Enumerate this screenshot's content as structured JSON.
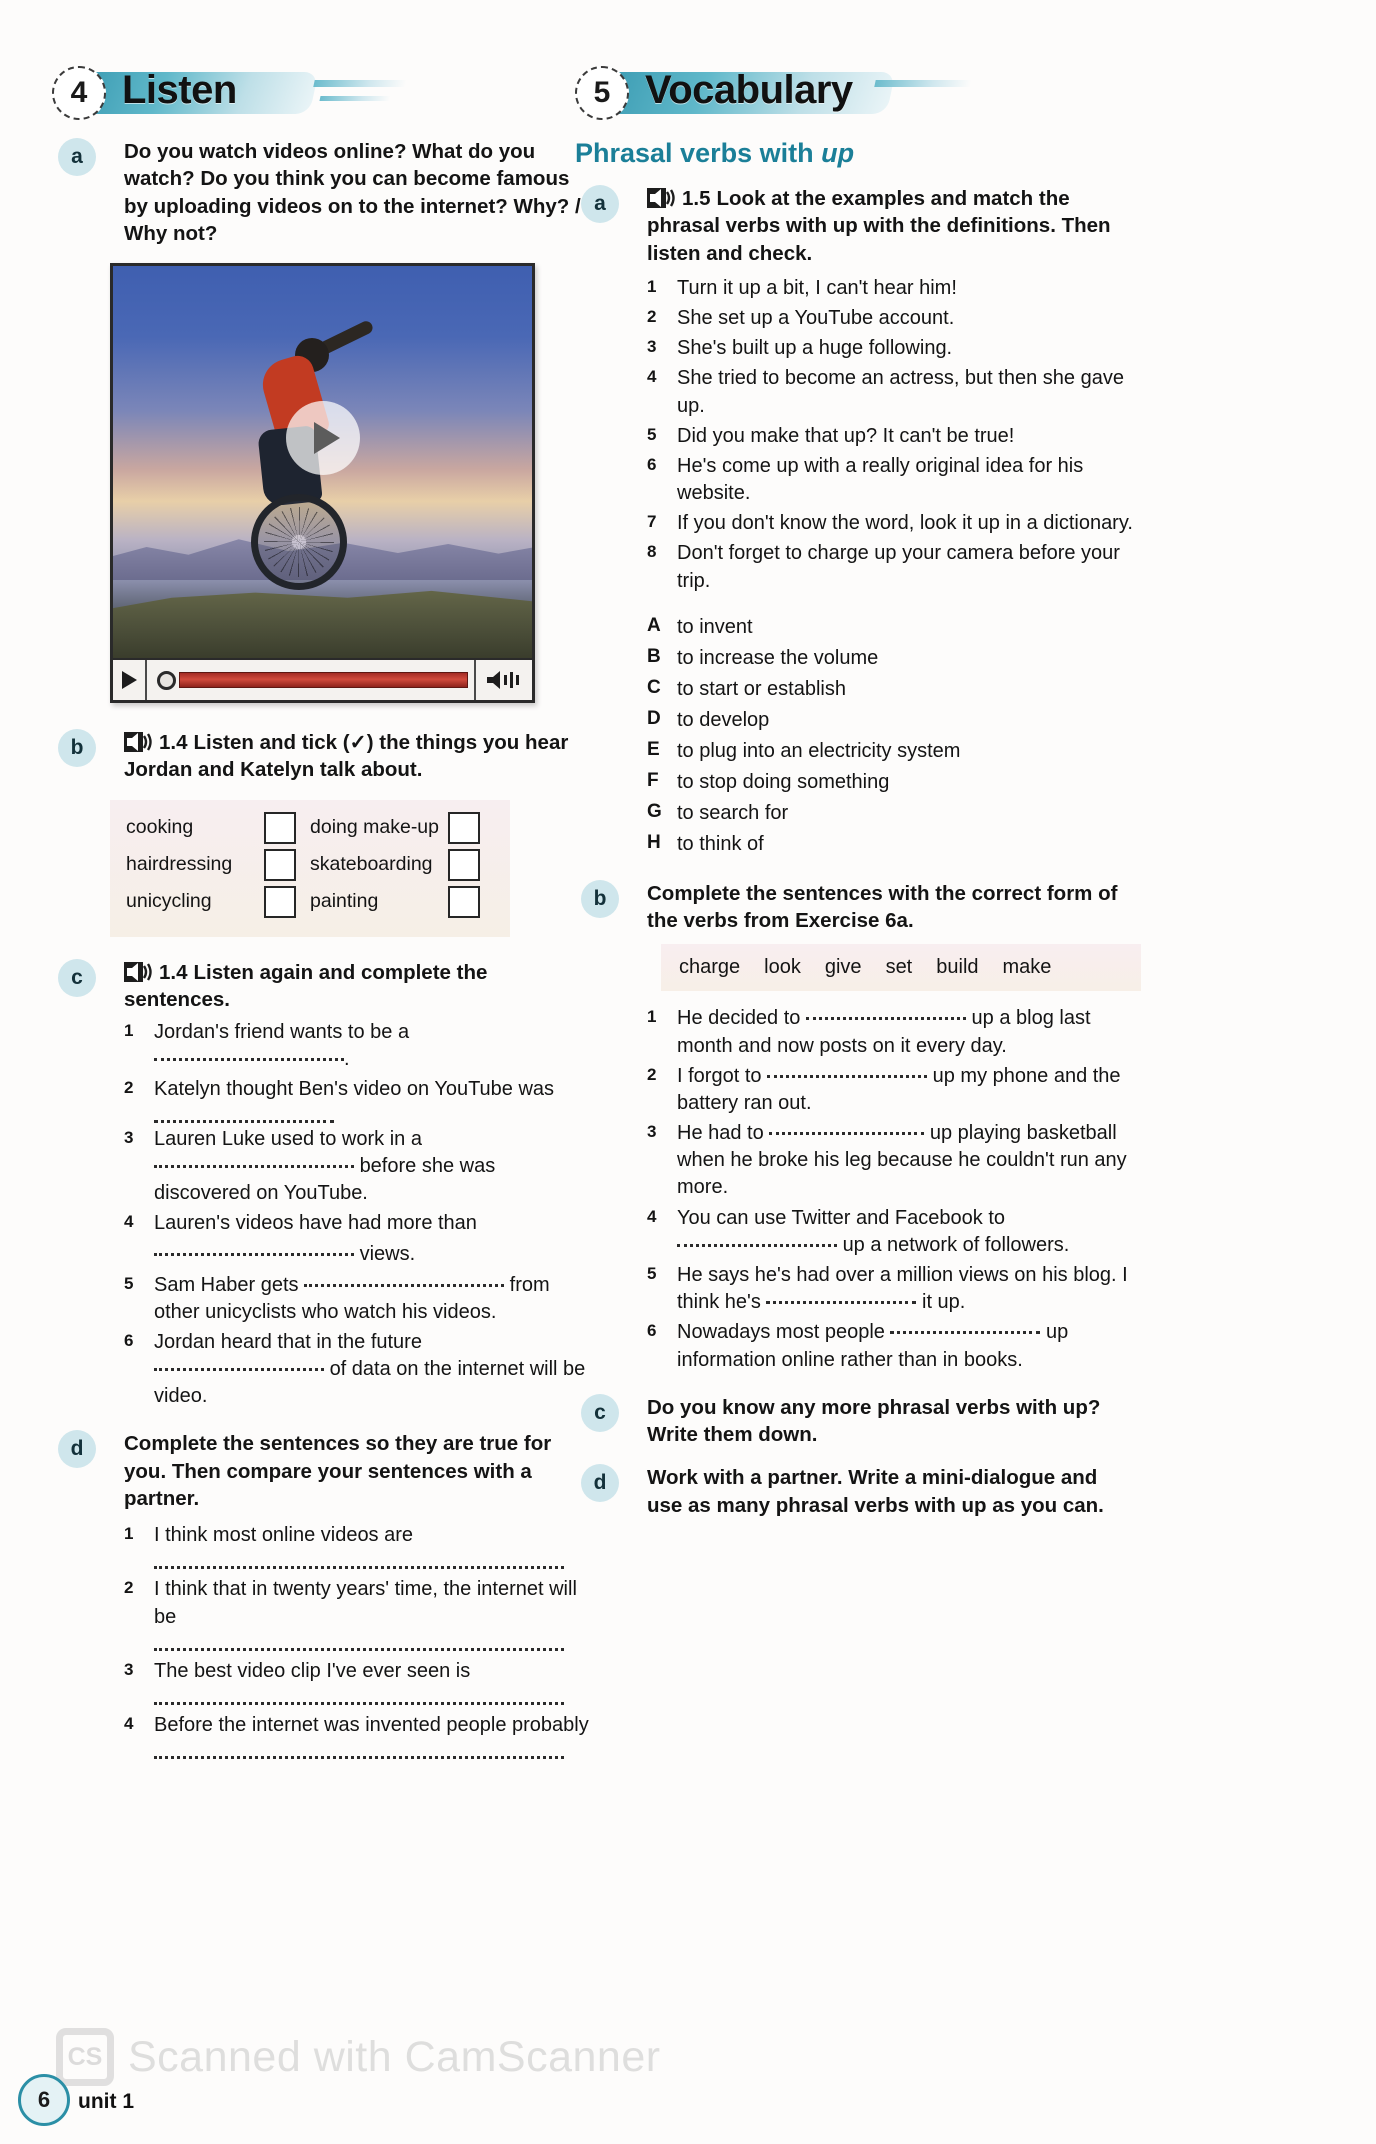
{
  "page": {
    "number": "6",
    "unit_label": "unit 1",
    "watermark_badge": "CS",
    "watermark_text": "Scanned with CamScanner",
    "accent_teal": "#1b7f98",
    "letter_badge_bg": "#cfe6ec"
  },
  "section_listen": {
    "number": "4",
    "title": "Listen",
    "a": {
      "letter": "a",
      "text": "Do you watch videos online? What do you watch? Do you think you can become famous by uploading videos on to the internet? Why? / Why not?"
    },
    "b": {
      "letter": "b",
      "track": "1.4",
      "text": "Listen and tick (✓) the things you hear Jordan and Katelyn talk about.",
      "options_left": [
        "cooking",
        "hairdressing",
        "unicycling"
      ],
      "options_right": [
        "doing make-up",
        "skateboarding",
        "painting"
      ]
    },
    "c": {
      "letter": "c",
      "track": "1.4",
      "text": "Listen again and complete the sentences.",
      "items": [
        "Jordan's friend wants to be a",
        "Katelyn thought Ben's video on YouTube was",
        "Lauren Luke used to work in a",
        "Lauren's videos have had more than",
        "Sam Haber gets",
        "Jordan heard that in the future"
      ],
      "item3_cont": "before she was discovered on YouTube.",
      "item4_cont": "views.",
      "item5_cont": "from other unicyclists who watch his videos.",
      "item6_cont": "of data on the internet will be video."
    },
    "d": {
      "letter": "d",
      "text": "Complete the sentences so they are true for you. Then compare your sentences with a partner.",
      "items": [
        "I think most online videos are",
        "I think that in twenty years' time, the internet will be",
        "The best video clip I've ever seen is",
        "Before the internet was invented people probably"
      ]
    }
  },
  "section_vocabulary": {
    "number": "5",
    "title": "Vocabulary",
    "subtitle_plain": "Phrasal verbs with ",
    "subtitle_italic": "up",
    "a": {
      "letter": "a",
      "track": "1.5",
      "text": "Look at the examples and match the phrasal verbs with up with the definitions. Then listen and check.",
      "examples": [
        "Turn it up a bit, I can't hear him!",
        "She set up a YouTube account.",
        "She's built up a huge following.",
        "She tried to become an actress, but then she gave up.",
        "Did you make that up? It can't be true!",
        "He's come up with a really original idea for his website.",
        "If you don't know the word, look it up in a dictionary.",
        "Don't forget to charge up your camera before your trip."
      ],
      "definitions": [
        {
          "letter": "A",
          "text": "to invent"
        },
        {
          "letter": "B",
          "text": "to increase the volume"
        },
        {
          "letter": "C",
          "text": "to start or establish"
        },
        {
          "letter": "D",
          "text": "to develop"
        },
        {
          "letter": "E",
          "text": "to plug into an electricity system"
        },
        {
          "letter": "F",
          "text": "to stop doing something"
        },
        {
          "letter": "G",
          "text": "to search for"
        },
        {
          "letter": "H",
          "text": "to think of"
        }
      ]
    },
    "b": {
      "letter": "b",
      "text": "Complete the sentences with the correct form of the verbs from Exercise 6a.",
      "wordbox": [
        "charge",
        "look",
        "give",
        "set",
        "build",
        "make"
      ],
      "items": [
        {
          "pre": "He decided to",
          "post": "up a blog last month and now posts on it every day."
        },
        {
          "pre": "I forgot to",
          "post": "up my phone and the battery ran out."
        },
        {
          "pre": "He had to",
          "post": "up playing basketball when he broke his leg because he couldn't run any more."
        },
        {
          "pre": "You can use Twitter and Facebook to",
          "post": "up a network of followers."
        },
        {
          "pre": "He says he's had over a million views on his blog. I think he's",
          "post": "it up."
        },
        {
          "pre": "Nowadays most people",
          "post": "up information online rather than in books."
        }
      ]
    },
    "c": {
      "letter": "c",
      "text": "Do you know any more phrasal verbs with up? Write them down."
    },
    "d": {
      "letter": "d",
      "text": "Work with a partner. Write a mini-dialogue and use as many phrasal verbs with up as you can."
    }
  }
}
